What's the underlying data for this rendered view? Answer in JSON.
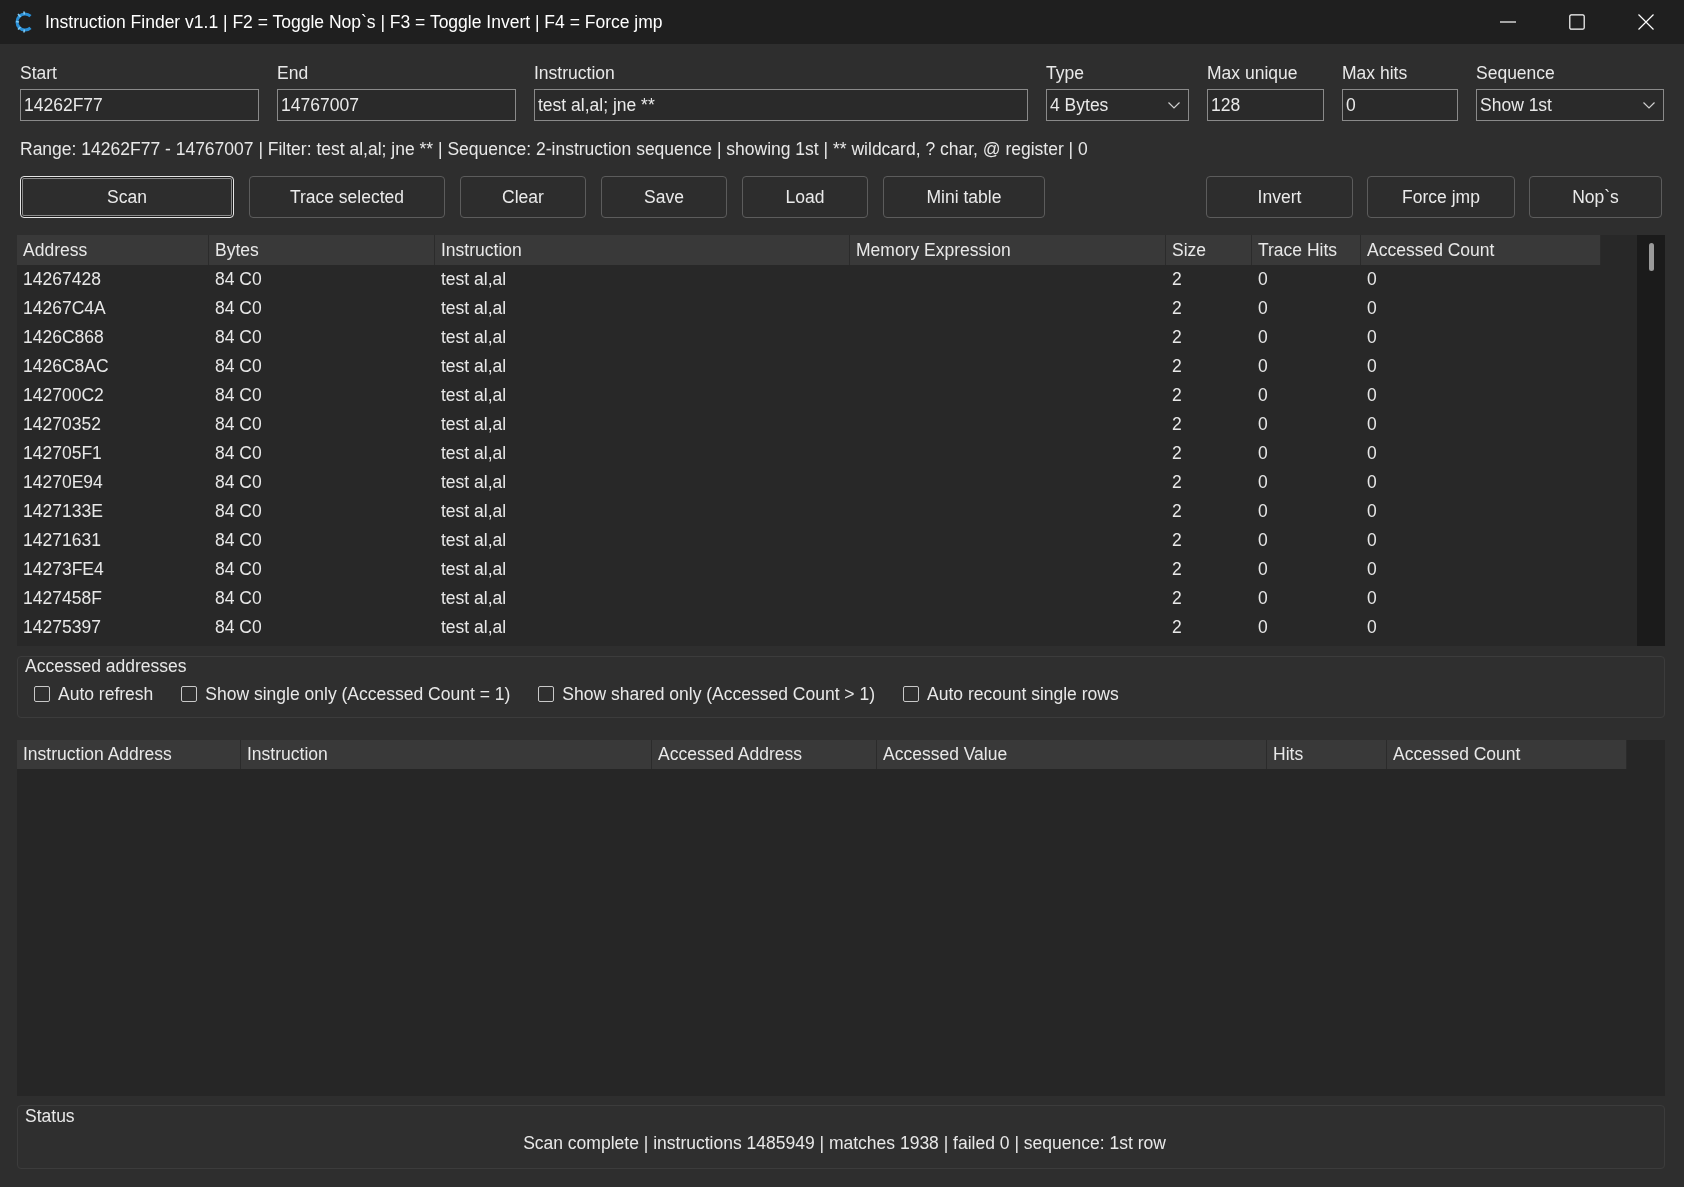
{
  "window": {
    "title": "Instruction Finder v1.1 | F2 = Toggle Nop`s | F3 = Toggle Invert | F4 = Force jmp"
  },
  "fields": [
    {
      "label": "Start",
      "kind": "text",
      "value": "14262F77"
    },
    {
      "label": "End",
      "kind": "text",
      "value": "14767007"
    },
    {
      "label": "Instruction",
      "kind": "text",
      "value": "test al,al; jne **"
    },
    {
      "label": "Type",
      "kind": "dropdown",
      "value": "4 Bytes"
    },
    {
      "label": "Max unique",
      "kind": "text",
      "value": "128"
    },
    {
      "label": "Max hits",
      "kind": "text",
      "value": "0"
    },
    {
      "label": "Sequence",
      "kind": "dropdown",
      "value": "Show 1st"
    }
  ],
  "info_line": "Range: 14262F77 - 14767007 | Filter: test al,al; jne ** | Sequence: 2-instruction sequence | showing 1st | ** wildcard, ? char, @ register | 0",
  "buttons_left": [
    {
      "label": "Scan",
      "focused": true
    },
    {
      "label": "Trace selected",
      "focused": false
    },
    {
      "label": "Clear",
      "focused": false
    },
    {
      "label": "Save",
      "focused": false
    },
    {
      "label": "Load",
      "focused": false
    },
    {
      "label": "Mini table",
      "focused": false
    }
  ],
  "buttons_right": [
    {
      "label": "Invert",
      "focused": false
    },
    {
      "label": "Force jmp",
      "focused": false
    },
    {
      "label": "Nop`s",
      "focused": false
    }
  ],
  "results_table": {
    "columns": [
      "Address",
      "Bytes",
      "Instruction",
      "Memory Expression",
      "Size",
      "Trace Hits",
      "Accessed Count"
    ],
    "rows": [
      {
        "address": "14267428",
        "bytes": "84 C0",
        "instruction": "test al,al",
        "size": "2",
        "trace_hits": "0",
        "accessed_count": "0"
      },
      {
        "address": "14267C4A",
        "bytes": "84 C0",
        "instruction": "test al,al",
        "size": "2",
        "trace_hits": "0",
        "accessed_count": "0"
      },
      {
        "address": "1426C868",
        "bytes": "84 C0",
        "instruction": "test al,al",
        "size": "2",
        "trace_hits": "0",
        "accessed_count": "0"
      },
      {
        "address": "1426C8AC",
        "bytes": "84 C0",
        "instruction": "test al,al",
        "size": "2",
        "trace_hits": "0",
        "accessed_count": "0"
      },
      {
        "address": "142700C2",
        "bytes": "84 C0",
        "instruction": "test al,al",
        "size": "2",
        "trace_hits": "0",
        "accessed_count": "0"
      },
      {
        "address": "14270352",
        "bytes": "84 C0",
        "instruction": "test al,al",
        "size": "2",
        "trace_hits": "0",
        "accessed_count": "0"
      },
      {
        "address": "142705F1",
        "bytes": "84 C0",
        "instruction": "test al,al",
        "size": "2",
        "trace_hits": "0",
        "accessed_count": "0"
      },
      {
        "address": "14270E94",
        "bytes": "84 C0",
        "instruction": "test al,al",
        "size": "2",
        "trace_hits": "0",
        "accessed_count": "0"
      },
      {
        "address": "1427133E",
        "bytes": "84 C0",
        "instruction": "test al,al",
        "size": "2",
        "trace_hits": "0",
        "accessed_count": "0"
      },
      {
        "address": "14271631",
        "bytes": "84 C0",
        "instruction": "test al,al",
        "size": "2",
        "trace_hits": "0",
        "accessed_count": "0"
      },
      {
        "address": "14273FE4",
        "bytes": "84 C0",
        "instruction": "test al,al",
        "size": "2",
        "trace_hits": "0",
        "accessed_count": "0"
      },
      {
        "address": "1427458F",
        "bytes": "84 C0",
        "instruction": "test al,al",
        "size": "2",
        "trace_hits": "0",
        "accessed_count": "0"
      },
      {
        "address": "14275397",
        "bytes": "84 C0",
        "instruction": "test al,al",
        "size": "2",
        "trace_hits": "0",
        "accessed_count": "0"
      }
    ]
  },
  "accessed_addresses": {
    "title": "Accessed addresses",
    "checkboxes": [
      {
        "label": "Auto refresh",
        "checked": false
      },
      {
        "label": "Show single only (Accessed Count = 1)",
        "checked": false
      },
      {
        "label": "Show shared only (Accessed Count > 1)",
        "checked": false
      },
      {
        "label": "Auto recount single rows",
        "checked": false
      }
    ]
  },
  "accessed_table": {
    "columns": [
      "Instruction Address",
      "Instruction",
      "Accessed Address",
      "Accessed Value",
      "Hits",
      "Accessed Count"
    ]
  },
  "status": {
    "title": "Status",
    "text": "Scan complete | instructions 1485949 | matches 1938 | failed 0 | sequence: 1st row"
  }
}
